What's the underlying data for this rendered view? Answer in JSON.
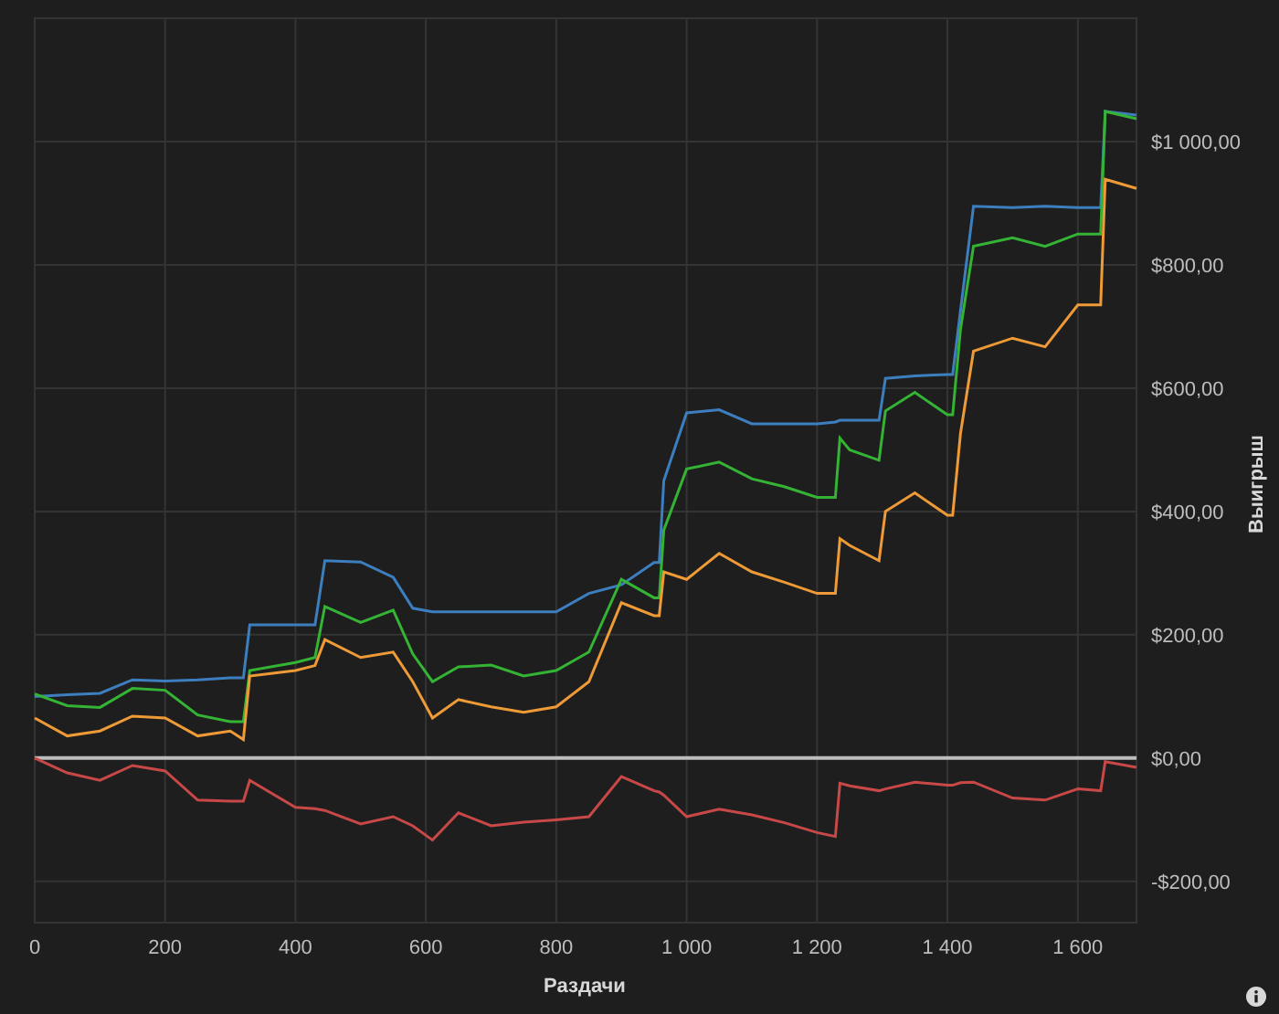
{
  "chart": {
    "chart_data": {
      "type": "line",
      "grid": true,
      "xlabel": "Раздачи",
      "ylabel": "Выигрыш",
      "xlim": [
        0,
        1690
      ],
      "ylim": [
        -267,
        1200
      ],
      "xticks": [
        {
          "value": 0,
          "label": "0"
        },
        {
          "value": 200,
          "label": "200"
        },
        {
          "value": 400,
          "label": "400"
        },
        {
          "value": 600,
          "label": "600"
        },
        {
          "value": 800,
          "label": "800"
        },
        {
          "value": 1000,
          "label": "1 000"
        },
        {
          "value": 1200,
          "label": "1 200"
        },
        {
          "value": 1400,
          "label": "1 400"
        },
        {
          "value": 1600,
          "label": "1 600"
        }
      ],
      "yticks": [
        {
          "value": -200,
          "label": "-$200,00"
        },
        {
          "value": 0,
          "label": "$0,00"
        },
        {
          "value": 200,
          "label": "$200,00"
        },
        {
          "value": 400,
          "label": "$400,00"
        },
        {
          "value": 600,
          "label": "$600,00"
        },
        {
          "value": 800,
          "label": "$800,00"
        },
        {
          "value": 1000,
          "label": "$1 000,00"
        }
      ],
      "x": [
        0,
        50,
        100,
        150,
        200,
        250,
        300,
        320,
        330,
        400,
        430,
        445,
        500,
        550,
        580,
        610,
        650,
        700,
        750,
        800,
        850,
        900,
        950,
        958,
        965,
        1000,
        1050,
        1100,
        1150,
        1200,
        1228,
        1235,
        1250,
        1295,
        1305,
        1350,
        1400,
        1408,
        1420,
        1440,
        1500,
        1550,
        1600,
        1635,
        1642,
        1690
      ],
      "series": [
        {
          "color": "#3d7ebf",
          "values": [
            100,
            103,
            105,
            127,
            125,
            127,
            130,
            130,
            216,
            216,
            216,
            320,
            318,
            293,
            243,
            237,
            237,
            237,
            237,
            237,
            267,
            281,
            317,
            317,
            450,
            560,
            565,
            542,
            542,
            542,
            545,
            548,
            548,
            548,
            616,
            620,
            622,
            622,
            726,
            895,
            893,
            895,
            893,
            893,
            1049,
            1043
          ]
        },
        {
          "color": "#34b334",
          "values": [
            104,
            85,
            82,
            113,
            110,
            70,
            59,
            59,
            142,
            155,
            163,
            246,
            220,
            240,
            169,
            124,
            148,
            151,
            133,
            142,
            172,
            290,
            260,
            260,
            370,
            469,
            480,
            453,
            440,
            423,
            423,
            519,
            500,
            483,
            563,
            593,
            557,
            557,
            696,
            830,
            844,
            830,
            850,
            850,
            1049,
            1037
          ]
        },
        {
          "color": "#ee9a36",
          "values": [
            65,
            36,
            44,
            68,
            65,
            36,
            44,
            30,
            133,
            142,
            150,
            192,
            163,
            172,
            124,
            65,
            95,
            83,
            74,
            83,
            124,
            252,
            231,
            231,
            302,
            290,
            332,
            302,
            285,
            267,
            267,
            356,
            345,
            320,
            400,
            430,
            394,
            394,
            527,
            660,
            681,
            667,
            735,
            735,
            939,
            924
          ]
        },
        {
          "color": "#c84848",
          "values": [
            0,
            -24,
            -36,
            -12,
            -21,
            -68,
            -70,
            -70,
            -36,
            -80,
            -82,
            -85,
            -107,
            -95,
            -110,
            -133,
            -89,
            -110,
            -104,
            -100,
            -95,
            -30,
            -53,
            -55,
            -60,
            -95,
            -83,
            -92,
            -105,
            -121,
            -127,
            -41,
            -45,
            -53,
            -50,
            -39,
            -44,
            -44,
            -40,
            -39,
            -65,
            -68,
            -50,
            -53,
            -6,
            -15
          ]
        }
      ]
    }
  }
}
